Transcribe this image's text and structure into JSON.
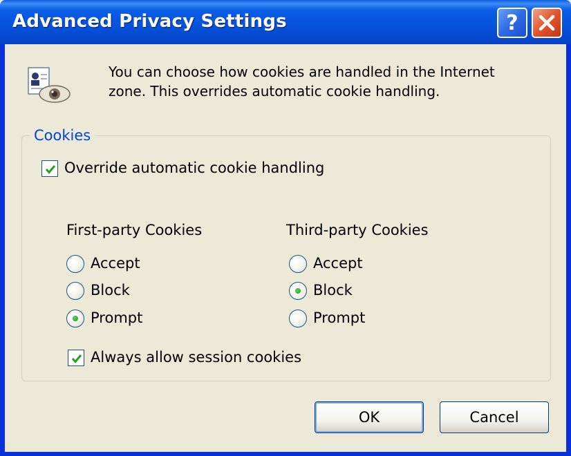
{
  "window": {
    "title": "Advanced Privacy Settings",
    "help_label": "?"
  },
  "intro": {
    "line1": "You can choose how cookies are handled in the Internet",
    "line2": "zone.  This overrides automatic cookie handling."
  },
  "cookies_group": {
    "label": "Cookies",
    "override_label": "Override automatic cookie handling",
    "override_checked": true,
    "first_party": {
      "heading": "First-party Cookies",
      "options": [
        "Accept",
        "Block",
        "Prompt"
      ],
      "selected": "Prompt"
    },
    "third_party": {
      "heading": "Third-party Cookies",
      "options": [
        "Accept",
        "Block",
        "Prompt"
      ],
      "selected": "Block"
    },
    "session_label": "Always allow session cookies",
    "session_checked": true
  },
  "buttons": {
    "ok": "OK",
    "cancel": "Cancel"
  },
  "colors": {
    "titlebar": "#0a5ee8",
    "group_label": "#0046d5",
    "check_mark": "#21a121",
    "close_button": "#e1552b"
  },
  "icons": {
    "intro": "privacy-eye-document-icon",
    "help": "help-icon",
    "close": "close-icon"
  }
}
